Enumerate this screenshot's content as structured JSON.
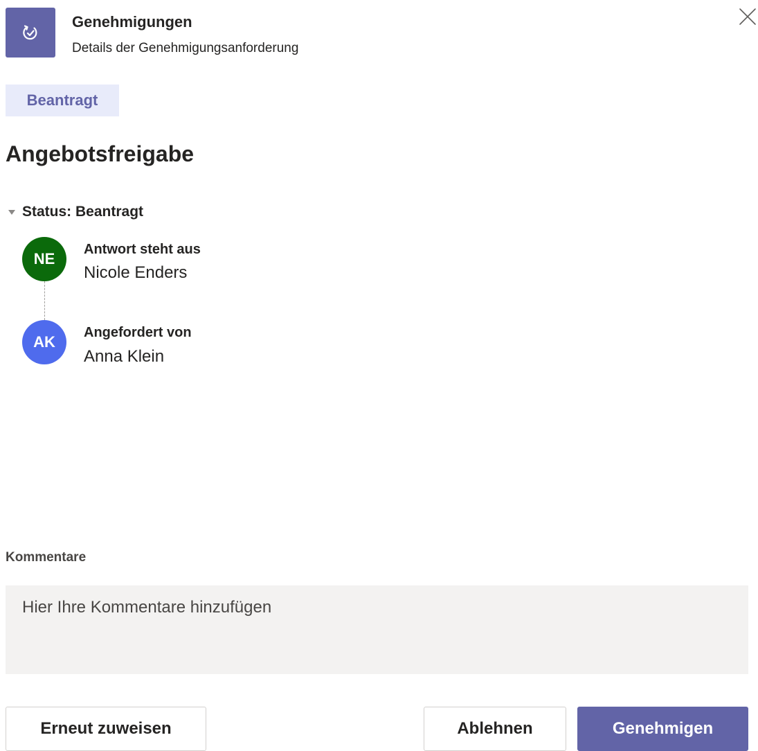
{
  "header": {
    "app_title": "Genehmigungen",
    "app_subtitle": "Details der Genehmigungsanforderung",
    "app_icon": "approvals-icon",
    "close_icon": "close-icon"
  },
  "request": {
    "status_badge": "Beantragt",
    "title": "Angebotsfreigabe",
    "status_toggle_label": "Status: Beantragt"
  },
  "people": [
    {
      "initials": "NE",
      "role": "Antwort steht aus",
      "name": "Nicole Enders",
      "avatar_color": "#0b6a0b"
    },
    {
      "initials": "AK",
      "role": "Angefordert von",
      "name": "Anna Klein",
      "avatar_color": "#4f6bed"
    }
  ],
  "comments": {
    "label": "Kommentare",
    "placeholder": "Hier Ihre Kommentare hinzufügen",
    "value": ""
  },
  "actions": {
    "reassign_label": "Erneut zuweisen",
    "reject_label": "Ablehnen",
    "approve_label": "Genehmigen"
  },
  "colors": {
    "brand": "#6264a7",
    "status_badge_bg": "#e8ebfa",
    "comments_bg": "#f3f2f1"
  }
}
